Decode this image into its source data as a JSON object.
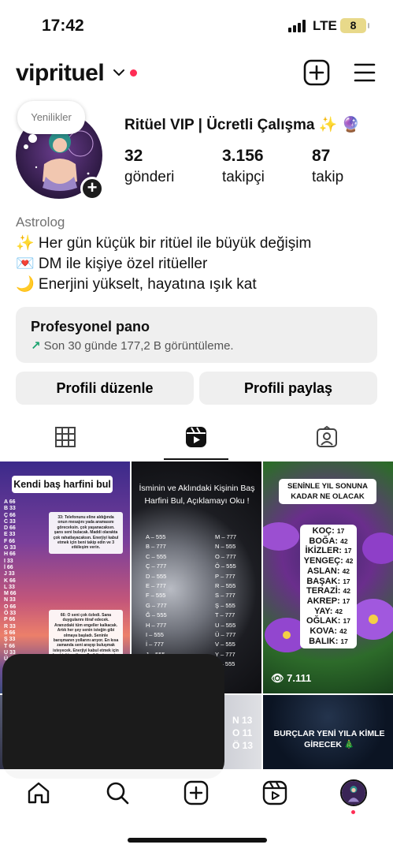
{
  "status_bar": {
    "time": "17:42",
    "network": "LTE",
    "battery": "8"
  },
  "header": {
    "username": "viprituel",
    "icons": [
      "chevron-down-icon",
      "create-post-icon",
      "menu-icon"
    ]
  },
  "note": {
    "label": "Yenilikler"
  },
  "profile": {
    "display_name": "Ritüel VIP | Ücretli Çalışma ✨ 🔮",
    "stats": [
      {
        "value": "32",
        "label": "gönderi"
      },
      {
        "value": "3.156",
        "label": "takipçi"
      },
      {
        "value": "87",
        "label": "takip"
      }
    ],
    "category": "Astrolog",
    "bio": [
      "✨ Her gün küçük bir ritüel ile büyük değişim",
      "💌 DM ile kişiye özel ritüeller",
      "🌙 Enerjini yükselt, hayatına ışık kat"
    ]
  },
  "dashboard": {
    "title": "Profesyonel pano",
    "arrow": "↗",
    "subtitle": "Son 30 günde 177,2 B görüntüleme."
  },
  "buttons": {
    "edit": "Profili düzenle",
    "share": "Profili paylaş"
  },
  "tabs": [
    "grid-icon",
    "reels-icon",
    "tagged-icon"
  ],
  "posts": {
    "p1": {
      "title": "Kendi baş harfini bul",
      "col": [
        "A 66",
        "B 33",
        "Ç 66",
        "C 33",
        "D 66",
        "E 33",
        "F 66",
        "G 33",
        "H 66",
        "I 33",
        "İ 66",
        "J 33",
        "K 66",
        "L 33",
        "M 66",
        "N 33",
        "O 66",
        "Ö 33",
        "P 66",
        "R 33",
        "S 66",
        "Ş 33",
        "T 66",
        "U 33",
        "Ü 66"
      ],
      "box1": "33: Telefonunu eline aldığında onun mesajını yada aramasını göreceksin. çok yaşanacaksın. şans seni bulacak. Maddi olarakta çok rahatlayacaksın. Enerjiyi kabul etmek için beni takip edin ve 3 etkileşim verin.",
      "box2": "66: O seni çok özledi. Sana duygularını itiraf edecek. Aranızdaki tüm engeller kalkacak. Artık her şey senin isteğin gibi olmaya başladı. Seninle barışmanın yollarını arıyor. En kısa zamanda seni arayıp buluşmak isteyecek. Enerjiyi kabul etmek için beni takip edin ve 3 etkileşim verin."
    },
    "p2": {
      "title": "İsminin ve Aklındaki Kişinin Baş Harfini Bul, Açıklamayı Oku !",
      "left": [
        "A – 555",
        "B – 777",
        "C – 555",
        "Ç – 777",
        "D – 555",
        "E – 777",
        "F – 555",
        "G – 777",
        "Ğ – 555",
        "H – 777",
        "I – 555",
        "İ – 777",
        "J – 555",
        "K – 777"
      ],
      "right": [
        "M – 777",
        "N – 555",
        "O – 777",
        "Ö – 555",
        "P – 777",
        "R – 555",
        "S – 777",
        "Ş – 555",
        "T – 777",
        "U – 555",
        "Ü – 777",
        "V – 555",
        "Y – 777",
        "Z – 555"
      ]
    },
    "p3": {
      "title": "SENİNLE YIL SONUNA KADAR NE OLACAK",
      "signs": [
        {
          "name": "KOÇ",
          "n": "17"
        },
        {
          "name": "BOĞA",
          "n": "42"
        },
        {
          "name": "İKİZLER",
          "n": "17"
        },
        {
          "name": "YENGEÇ",
          "n": "42"
        },
        {
          "name": "ASLAN",
          "n": "42"
        },
        {
          "name": "BAŞAK",
          "n": "17"
        },
        {
          "name": "TERAZİ",
          "n": "42"
        },
        {
          "name": "AKREP",
          "n": "17"
        },
        {
          "name": "YAY",
          "n": "42"
        },
        {
          "name": "OĞLAK",
          "n": "17"
        },
        {
          "name": "KOVA",
          "n": "42"
        },
        {
          "name": "BALIK",
          "n": "17"
        }
      ],
      "views": "7.111"
    },
    "p5": {
      "letters": [
        "N 13",
        "O 11",
        "Ö 13"
      ]
    },
    "p6": {
      "title": "BURÇLAR YENİ YILA KİMLE GİRECEK 🎄"
    }
  },
  "bottom_nav": [
    "home-icon",
    "search-icon",
    "create-icon",
    "reels-nav-icon",
    "profile-avatar"
  ]
}
